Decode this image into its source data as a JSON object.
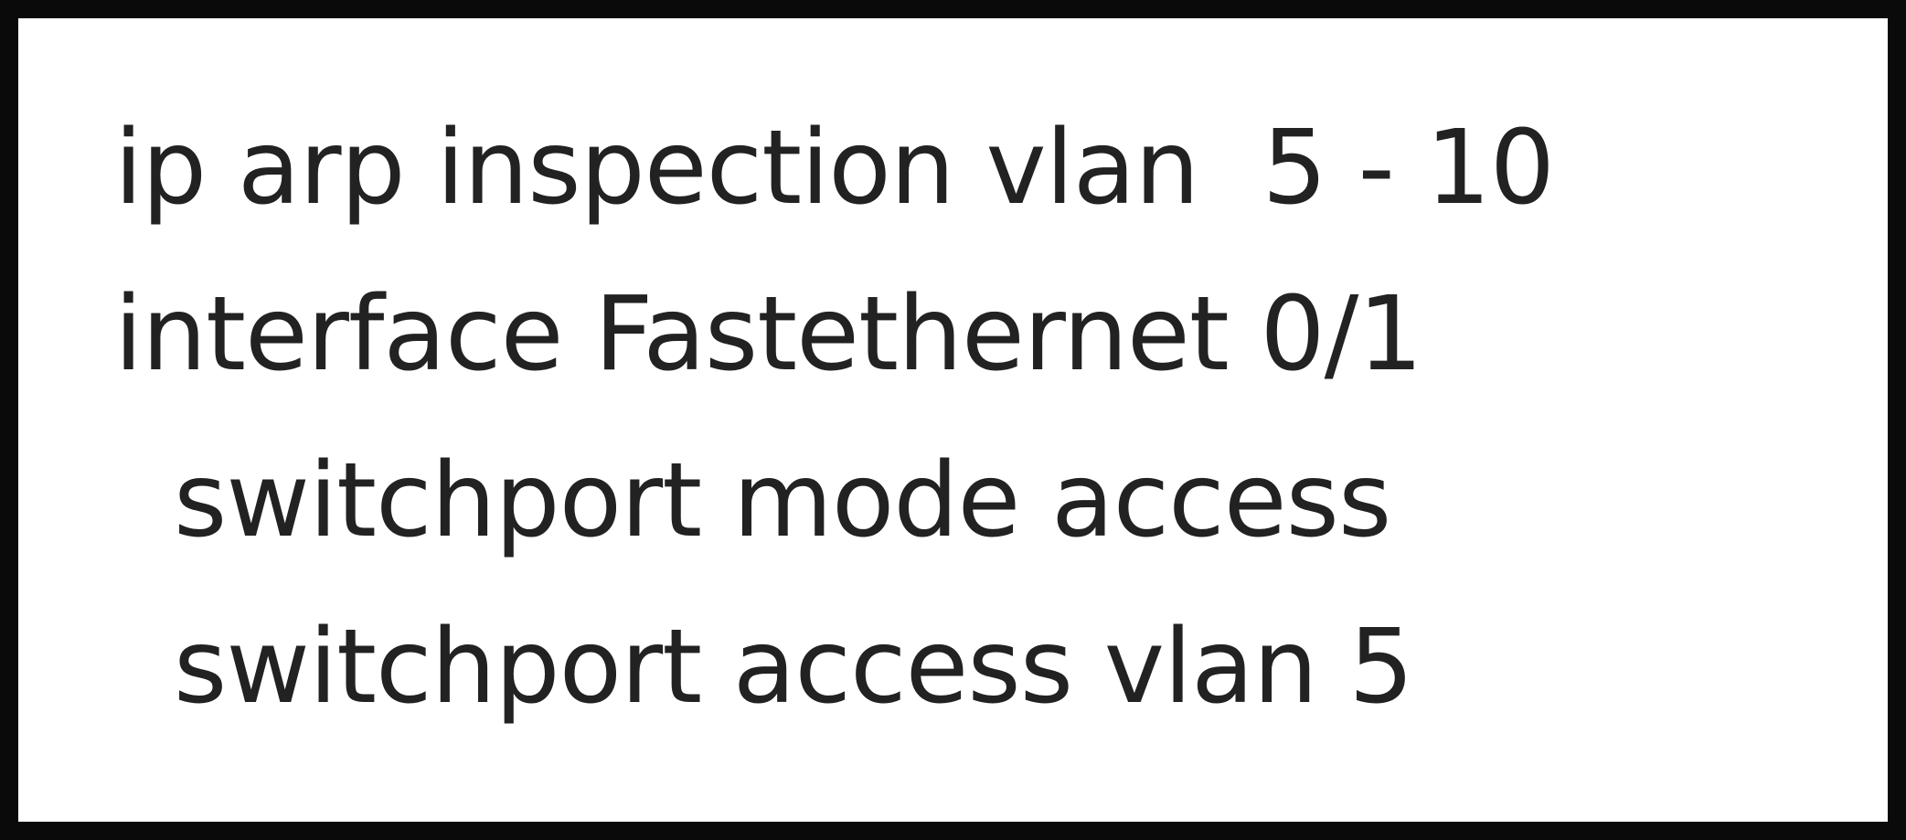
{
  "config_lines": [
    "ip arp inspection vlan  5 - 10",
    "interface Fastethernet 0/1",
    "switchport mode access",
    "switchport access vlan 5"
  ],
  "colors": {
    "border": "#0a0a0a",
    "text": "#222222",
    "background": "#ffffff"
  }
}
